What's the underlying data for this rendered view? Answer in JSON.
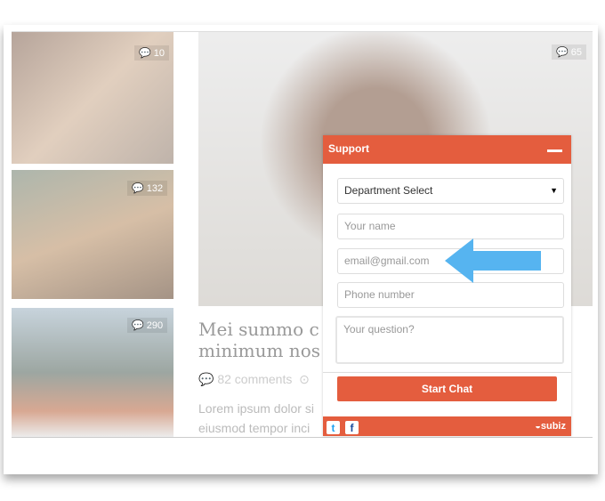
{
  "posts": {
    "thumbs": [
      {
        "comments": "10"
      },
      {
        "comments": "132"
      },
      {
        "comments": "290"
      }
    ],
    "featured": {
      "comments": "65",
      "title_line1": "Mei summo c",
      "title_line2": "minimum nos",
      "comments_label": "82 comments",
      "body_line1": "Lorem ipsum dolor si",
      "body_line2": "eiusmod tempor inci"
    }
  },
  "widget": {
    "title": "Support",
    "department": "Department Select",
    "name_placeholder": "Your name",
    "email_placeholder": "email@gmail.com",
    "phone_placeholder": "Phone number",
    "question_placeholder": "Your question?",
    "submit": "Start Chat",
    "brand": "subiz",
    "accent": "#e45d3e"
  },
  "annotation": {
    "arrow_color": "#56b4f0",
    "icon": "arrow-left-icon"
  }
}
